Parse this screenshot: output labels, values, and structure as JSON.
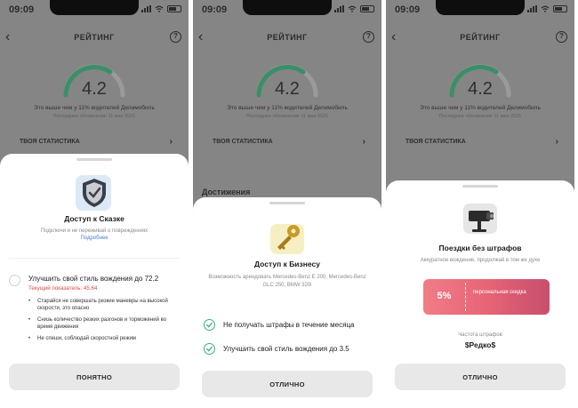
{
  "status": {
    "time": "09:09"
  },
  "rating_screen": {
    "title": "РЕЙТИНГ",
    "score": "4.2",
    "above_text": "Это выше чем у 11% водителей Делимобиль",
    "updated_text": "Последнее обновление 11 мая 2021",
    "stats_label": "ТВОЯ СТАТИСТИКА",
    "achievements_label": "Достижения"
  },
  "sheet1": {
    "title": "Доступ к Сказке",
    "subtitle": "Подключи и не переживай о повреждениях",
    "link": "Подробнее",
    "goal": "Улучшить свой стиль вождения до 72.2",
    "current": "Текущий показатель: 45.64",
    "tips": [
      "Старайся не совершать резкие маневры на высокой скорости, это опасно",
      "Снизь количество резких разгонов и торможений во время движения",
      "Не спеши, соблюдай скоростной режим"
    ],
    "button": "ПОНЯТНО"
  },
  "sheet2": {
    "title": "Доступ к Бизнесу",
    "subtitle": "Возможность арендовать Mercedes-Benz E 200, Mercedes-Benz GLC 250, BMW 320i",
    "goals": [
      "Не получать штрафы в течение месяца",
      "Улучшить свой стиль вождения до 3.5"
    ],
    "button": "ОТЛИЧНО"
  },
  "sheet3": {
    "title": "Поездки без штрафов",
    "subtitle": "Аккуратное вождение, продолжай в том же духе",
    "coupon_percent": "5%",
    "coupon_label": "персональная скидка",
    "frequency_label": "Частота штрафов",
    "frequency_value": "$Редко$",
    "button": "ОТЛИЧНО"
  },
  "colors": {
    "gauge_green": "#3cae7b",
    "check_green": "#33b07a",
    "current_red": "#e0464a",
    "link_blue": "#4a7bd6",
    "coupon_start": "#f07d86",
    "coupon_end": "#c74f6d"
  }
}
